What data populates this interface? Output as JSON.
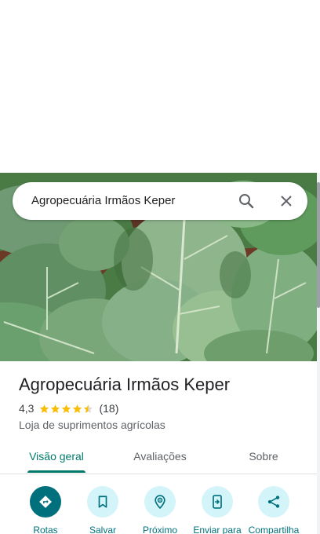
{
  "search": {
    "query": "Agropecuária Irmãos Keper",
    "search_icon": "search-icon",
    "close_icon": "close-icon"
  },
  "hero_photo": {
    "icon": "cabbage-field-photo"
  },
  "place": {
    "name": "Agropecuária Irmãos Keper",
    "rating_value": "4,3",
    "stars": 4.3,
    "review_count": "(18)",
    "category": "Loja de suprimentos agrícolas"
  },
  "tabs": [
    {
      "label": "Visão geral",
      "selected": true
    },
    {
      "label": "Avaliações",
      "selected": false
    },
    {
      "label": "Sobre",
      "selected": false
    }
  ],
  "actions": [
    {
      "label": "Rotas",
      "icon": "directions-icon"
    },
    {
      "label": "Salvar",
      "icon": "bookmark-icon"
    },
    {
      "label": "Próximo",
      "icon": "nearby-icon"
    },
    {
      "label": "Enviar para",
      "icon": "send-to-phone-icon"
    },
    {
      "label": "Compartilha",
      "icon": "share-icon"
    }
  ],
  "colors": {
    "accent": "#00796b",
    "action_fill": "#d3f4f9",
    "action_primary": "#00707c",
    "star": "#fbbc04"
  }
}
